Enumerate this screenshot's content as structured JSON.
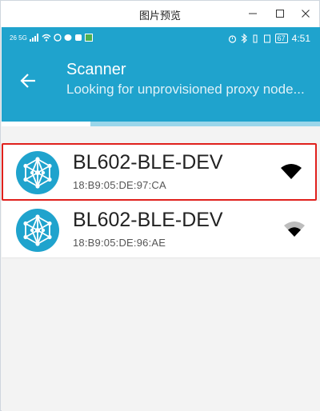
{
  "window": {
    "title": "图片预览"
  },
  "statusbar": {
    "left_text": "26 5G",
    "battery": "67",
    "time": "4:51"
  },
  "toolbar": {
    "title": "Scanner",
    "subtitle": "Looking for unprovisioned proxy node...",
    "progress_fraction": 0.28
  },
  "devices": [
    {
      "name": "BL602-BLE-DEV",
      "address": "18:B9:05:DE:97:CA",
      "selected": true
    },
    {
      "name": "BL602-BLE-DEV",
      "address": "18:B9:05:DE:96:AE",
      "selected": false
    }
  ],
  "colors": {
    "accent": "#1fa3cd",
    "selection": "#e0201c"
  },
  "icons": [
    "back-arrow-icon",
    "mesh-node-icon",
    "signal-strength-icon",
    "minimize-icon",
    "maximize-icon",
    "close-icon"
  ]
}
